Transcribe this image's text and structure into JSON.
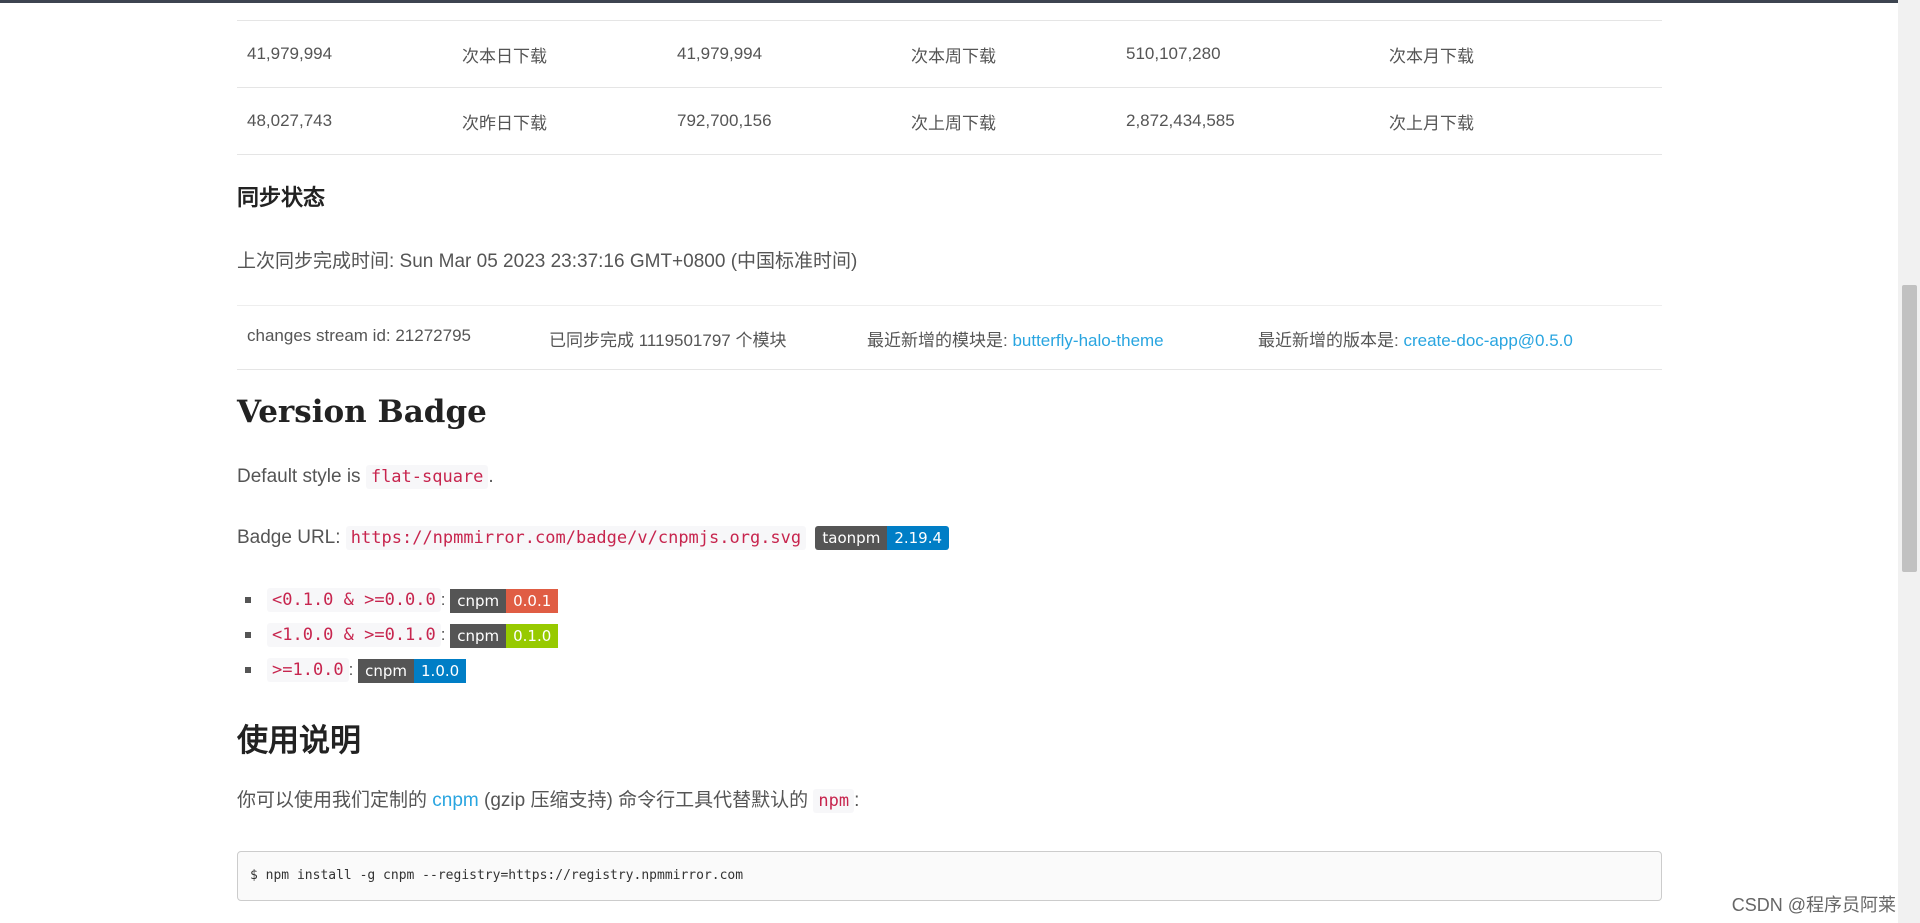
{
  "downloads": {
    "rows": [
      [
        "41,979,994",
        "次本日下载",
        "41,979,994",
        "次本周下载",
        "510,107,280",
        "次本月下载"
      ],
      [
        "48,027,743",
        "次昨日下载",
        "792,700,156",
        "次上周下载",
        "2,872,434,585",
        "次上月下载"
      ]
    ]
  },
  "sync": {
    "title": "同步状态",
    "last_sync": "上次同步完成时间: Sun Mar 05 2023 23:37:16 GMT+0800 (中国标准时间)",
    "stream_id": "changes stream id: 21272795",
    "synced": "已同步完成 1119501797 个模块",
    "latest_module_label": "最近新增的模块是: ",
    "latest_module": "butterfly-halo-theme",
    "latest_version_label": "最近新增的版本是: ",
    "latest_version": "create-doc-app@0.5.0"
  },
  "version_badge": {
    "title": "Version Badge",
    "default_prefix": "Default style is ",
    "default_code": "flat-square",
    "default_suffix": ".",
    "url_label": "Badge URL: ",
    "url_code": "https://npmmirror.com/badge/v/cnpmjs.org.svg",
    "badge_left": "taonpm",
    "badge_right": "2.19.4",
    "items": [
      {
        "range": "<0.1.0 & >=0.0.0",
        "badge_left": "cnpm",
        "badge_right": "0.0.1",
        "color": "#e05d44"
      },
      {
        "range": "<1.0.0 & >=0.1.0",
        "badge_left": "cnpm",
        "badge_right": "0.1.0",
        "color": "#97ca00"
      },
      {
        "range": ">=1.0.0",
        "badge_left": "cnpm",
        "badge_right": "1.0.0",
        "color": "#007ec6"
      }
    ],
    "colon": ":"
  },
  "usage": {
    "title": "使用说明",
    "text_prefix": "你可以使用我们定制的 ",
    "cnpm_link": "cnpm",
    "text_middle": " (gzip 压缩支持) 命令行工具代替默认的 ",
    "npm_code": "npm",
    "text_suffix": ":",
    "command": "$ npm install -g cnpm --registry=https://registry.npmmirror.com"
  },
  "watermark": "CSDN @程序员阿莱",
  "colors": {
    "link": "#29a5e0",
    "code": "#c7254e",
    "badge_blue": "#007ec6"
  }
}
